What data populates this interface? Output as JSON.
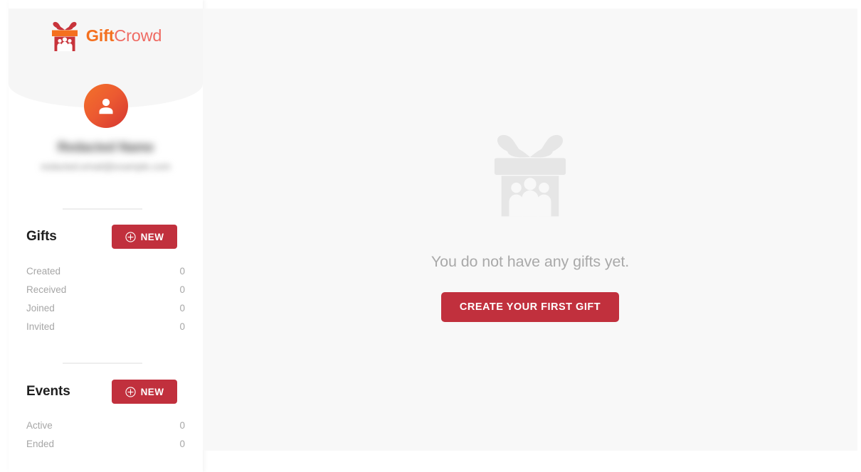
{
  "brand": {
    "name_part1": "Gift",
    "name_part2": "Crowd",
    "logo_icon": "gift-crowd-logo-icon",
    "color_orange": "#f4701f",
    "color_salmon": "#ef6b63",
    "color_red": "#c1303d"
  },
  "sidebar": {
    "avatar_icon": "user-avatar-icon",
    "user_name": "Redacted Name",
    "user_email": "redacted.email@example.com",
    "sections": [
      {
        "id": "gifts",
        "title": "Gifts",
        "new_button_label": "NEW",
        "new_button_icon": "plus-circle-icon",
        "rows": [
          {
            "label": "Created",
            "value": "0"
          },
          {
            "label": "Received",
            "value": "0"
          },
          {
            "label": "Joined",
            "value": "0"
          },
          {
            "label": "Invited",
            "value": "0"
          }
        ]
      },
      {
        "id": "events",
        "title": "Events",
        "new_button_label": "NEW",
        "new_button_icon": "plus-circle-icon",
        "rows": [
          {
            "label": "Active",
            "value": "0"
          },
          {
            "label": "Ended",
            "value": "0"
          }
        ]
      }
    ]
  },
  "main": {
    "empty_state": {
      "icon": "gift-crowd-placeholder-icon",
      "message": "You do not have any gifts yet.",
      "cta_label": "CREATE YOUR FIRST GIFT"
    }
  }
}
